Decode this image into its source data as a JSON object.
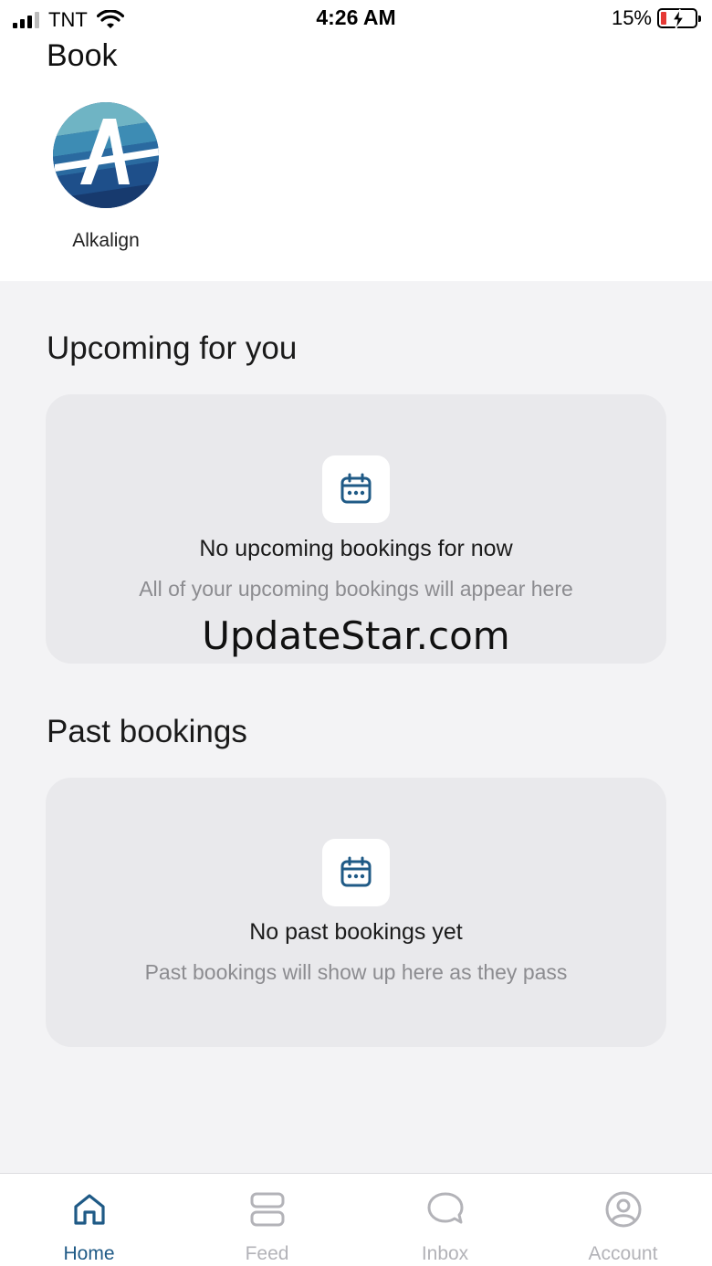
{
  "status_bar": {
    "carrier": "TNT",
    "time": "4:26 AM",
    "battery_percent": "15%",
    "battery_color": "#e53935"
  },
  "header": {
    "title": "Book"
  },
  "provider": {
    "name": "Alkalign",
    "logo_icon": "alkalign-logo"
  },
  "upcoming": {
    "section_title": "Upcoming for you",
    "icon": "calendar-icon",
    "empty_title": "No upcoming bookings for now",
    "empty_subtitle": "All of your upcoming bookings will appear here"
  },
  "watermark": "UpdateStar.com",
  "past": {
    "section_title": "Past bookings",
    "icon": "calendar-icon",
    "empty_title": "No past bookings yet",
    "empty_subtitle": "Past bookings will show up here as they pass"
  },
  "tab_bar": {
    "active_color": "#1f5a86",
    "items": [
      {
        "label": "Home",
        "icon": "home-icon",
        "active": true
      },
      {
        "label": "Feed",
        "icon": "feed-icon",
        "active": false
      },
      {
        "label": "Inbox",
        "icon": "inbox-icon",
        "active": false
      },
      {
        "label": "Account",
        "icon": "account-icon",
        "active": false
      }
    ]
  }
}
